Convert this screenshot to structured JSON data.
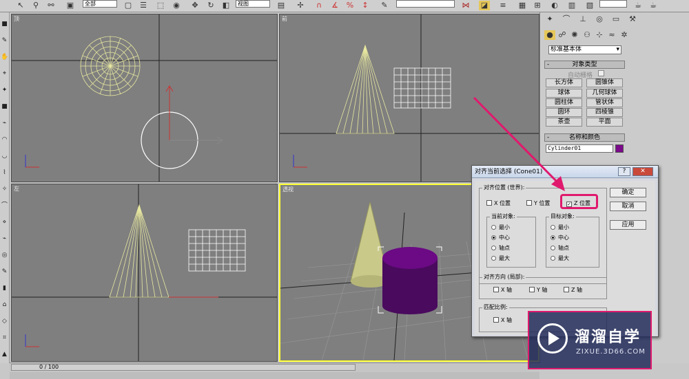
{
  "toolbar": {
    "filter_dropdown": "全部",
    "coord_dropdown": "视图",
    "icons": [
      "select-icon",
      "link-icon",
      "unlink-icon",
      "bind-icon",
      "select-filter-icon",
      "select-object-icon",
      "select-by-name-icon",
      "rect-select-icon",
      "move-icon",
      "rotate-icon",
      "scale-icon",
      "pivot-icon",
      "snap-icon",
      "angle-snap-icon",
      "percent-snap-icon",
      "spinner-snap-icon",
      "mirror-icon",
      "align-icon",
      "layer-icon",
      "curve-editor-icon",
      "material-icon",
      "render-icon",
      "teapot-icon"
    ]
  },
  "viewports": {
    "top": {
      "label": "顶"
    },
    "front": {
      "label": "前"
    },
    "left": {
      "label": "左"
    },
    "perspective": {
      "label": "透视"
    }
  },
  "command_panel": {
    "category_dropdown": "标准基本体",
    "object_type_header": "对象类型",
    "autogrid_label": "自动栅格",
    "object_buttons": [
      "长方体",
      "圆锥体",
      "球体",
      "几何球体",
      "圆柱体",
      "管状体",
      "圆环",
      "四棱锥",
      "茶壶",
      "平面"
    ],
    "name_color_header": "名称和颜色",
    "object_name": "Cylinder01",
    "object_color": "#7a0a8a"
  },
  "dialog": {
    "title": "对齐当前选择 (Cone01)",
    "help_button": "?",
    "close_button": "✕",
    "align_position_group": "对齐位置 (世界):",
    "x_pos": "X 位置",
    "y_pos": "Y 位置",
    "z_pos": "Z 位置",
    "current_object_group": "当前对象:",
    "target_object_group": "目标对象:",
    "options": [
      "最小",
      "中心",
      "轴点",
      "最大"
    ],
    "orient_group": "对齐方向 (局部):",
    "x_axis": "X 轴",
    "y_axis": "Y 轴",
    "z_axis": "Z 轴",
    "scale_group": "匹配比例:",
    "ok": "确定",
    "cancel": "取消",
    "apply": "应用"
  },
  "timeline": {
    "frame_display": "0 / 100"
  },
  "watermark": {
    "brand": "溜溜自学",
    "url": "ZIXUE.3D66.COM"
  },
  "colors": {
    "viewport_bg": "#7f7f7f",
    "active_border": "#ffff33",
    "wire_yellow": "#e8e8a0",
    "highlight": "#e0196d",
    "cylinder_purple": "#5a0a6e"
  }
}
